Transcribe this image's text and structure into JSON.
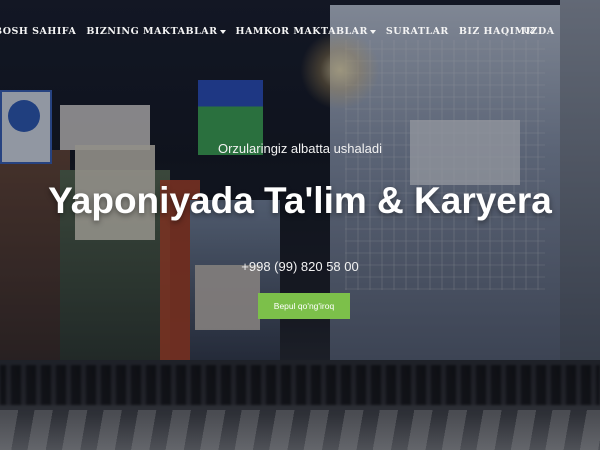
{
  "nav": {
    "items": [
      {
        "label": "BOSH SAHIFA",
        "dropdown": false
      },
      {
        "label": "BIZNING MAKTABLAR",
        "dropdown": true
      },
      {
        "label": "HAMKOR MAKTABLAR",
        "dropdown": true
      },
      {
        "label": "SURATLAR",
        "dropdown": false
      },
      {
        "label": "BIZ HAQIMIZDA",
        "dropdown": false
      }
    ],
    "language": "UZ"
  },
  "hero": {
    "tagline": "Orzularingiz albatta ushaladi",
    "title": "Yaponiyada Ta'lim & Karyera",
    "phone": "+998 (99) 820 58 00",
    "cta_label": "Bepul qo'ng'iroq"
  },
  "colors": {
    "cta_background": "#7cc04a",
    "text": "#ffffff"
  }
}
